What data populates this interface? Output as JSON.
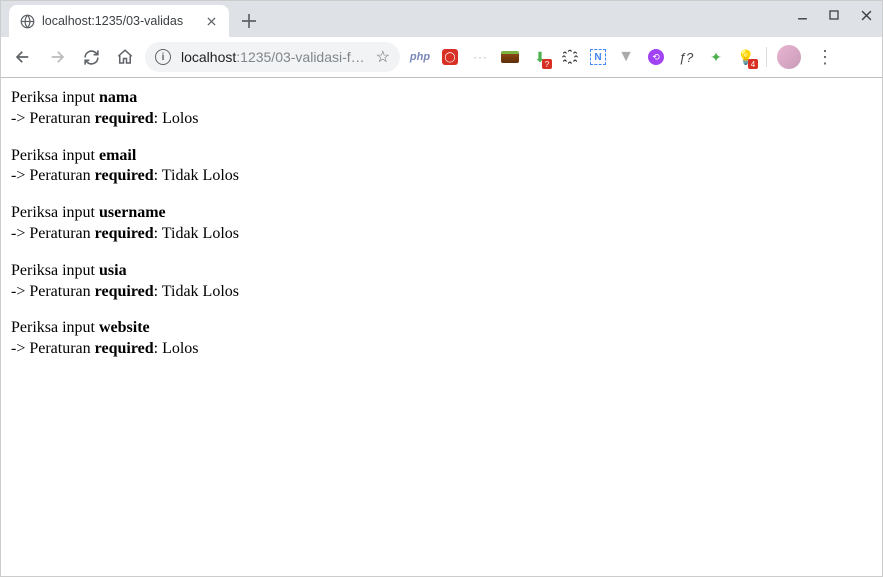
{
  "window": {
    "tab_title": "localhost:1235/03-validas",
    "url_host": "localhost",
    "url_path": ":1235/03-validasi-f…"
  },
  "extensions": {
    "php": "php",
    "badge_question": "?",
    "badge_4": "4",
    "f_question": "ƒ?"
  },
  "labels": {
    "check_prefix": "Periksa input ",
    "rule_prefix": "-> Peraturan ",
    "result_sep": ": "
  },
  "validations": [
    {
      "field": "nama",
      "rule": "required",
      "result": "Lolos"
    },
    {
      "field": "email",
      "rule": "required",
      "result": "Tidak Lolos"
    },
    {
      "field": "username",
      "rule": "required",
      "result": "Tidak Lolos"
    },
    {
      "field": "usia",
      "rule": "required",
      "result": "Tidak Lolos"
    },
    {
      "field": "website",
      "rule": "required",
      "result": "Lolos"
    }
  ]
}
